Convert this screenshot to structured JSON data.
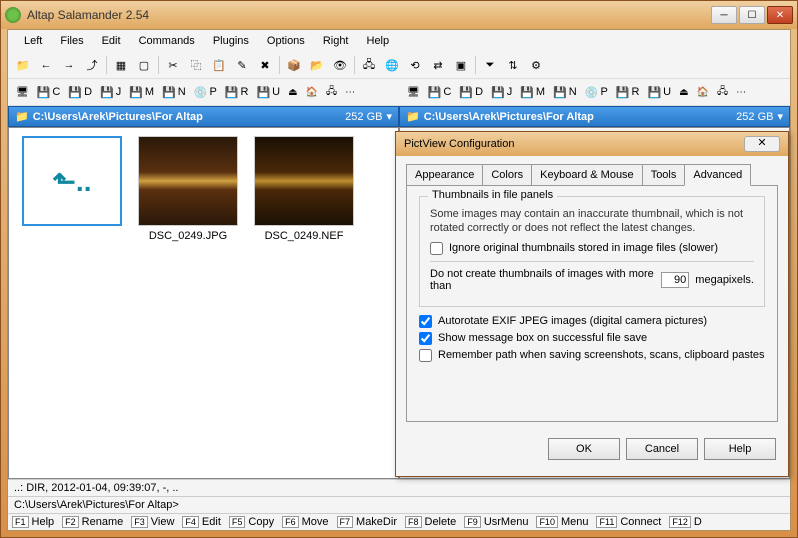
{
  "window": {
    "title": "Altap Salamander 2.54"
  },
  "menu": [
    "Left",
    "Files",
    "Edit",
    "Commands",
    "Plugins",
    "Options",
    "Right",
    "Help"
  ],
  "drives": [
    "C",
    "D",
    "J",
    "M",
    "N",
    "P",
    "R",
    "U"
  ],
  "path": {
    "text": "C:\\Users\\Arek\\Pictures\\For Altap",
    "size": "252 GB"
  },
  "thumbs": [
    {
      "label": ""
    },
    {
      "label": "DSC_0249.JPG"
    },
    {
      "label": "DSC_0249.NEF"
    }
  ],
  "status": "..: DIR, 2012-01-04, 09:39:07, -, ..",
  "cmdline": "C:\\Users\\Arek\\Pictures\\For Altap>",
  "fkeys": [
    {
      "k": "F1",
      "l": "Help"
    },
    {
      "k": "F2",
      "l": "Rename"
    },
    {
      "k": "F3",
      "l": "View"
    },
    {
      "k": "F4",
      "l": "Edit"
    },
    {
      "k": "F5",
      "l": "Copy"
    },
    {
      "k": "F6",
      "l": "Move"
    },
    {
      "k": "F7",
      "l": "MakeDir"
    },
    {
      "k": "F8",
      "l": "Delete"
    },
    {
      "k": "F9",
      "l": "UsrMenu"
    },
    {
      "k": "F10",
      "l": "Menu"
    },
    {
      "k": "F11",
      "l": "Connect"
    },
    {
      "k": "F12",
      "l": "D"
    }
  ],
  "dialog": {
    "title": "PictView Configuration",
    "tabs": [
      "Appearance",
      "Colors",
      "Keyboard & Mouse",
      "Tools",
      "Advanced"
    ],
    "group_title": "Thumbnails in file panels",
    "info": "Some images may contain an inaccurate thumbnail, which is not rotated correctly or does not reflect the latest changes.",
    "chk_ignore": "Ignore original thumbnails stored in image files (slower)",
    "megapixel_prefix": "Do not create thumbnails of images with more than",
    "megapixel_value": "90",
    "megapixel_suffix": "megapixels.",
    "chk_autorotate": "Autorotate EXIF JPEG images (digital camera pictures)",
    "chk_msgbox": "Show message box on successful file save",
    "chk_remember": "Remember path when saving screenshots, scans, clipboard pastes",
    "btn_ok": "OK",
    "btn_cancel": "Cancel",
    "btn_help": "Help"
  }
}
